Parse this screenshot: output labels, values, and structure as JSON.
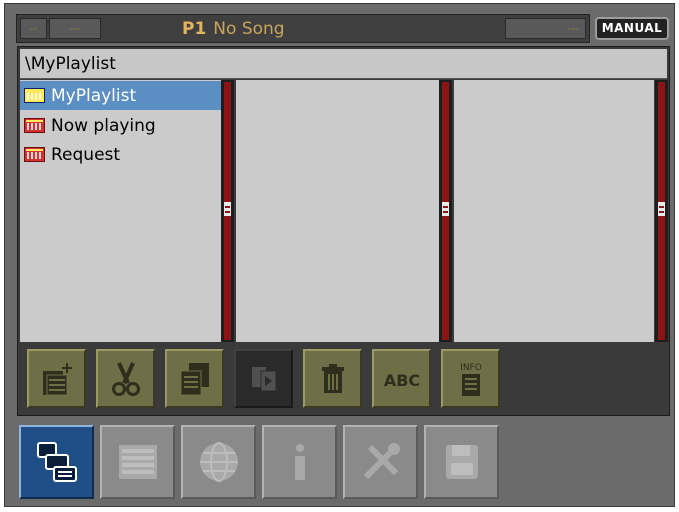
{
  "topbar": {
    "seg_a": "--",
    "seg_b": "---",
    "program": "P1",
    "song": "No Song",
    "seg_c": "---",
    "mode_button": "MANUAL"
  },
  "browser": {
    "path": "\\MyPlaylist",
    "items": [
      {
        "label": "MyPlaylist",
        "icon": "playlist-blue-icon",
        "selected": true
      },
      {
        "label": "Now playing",
        "icon": "playlist-red-icon",
        "selected": false
      },
      {
        "label": "Request",
        "icon": "playlist-red-icon",
        "selected": false
      }
    ]
  },
  "actions": {
    "info_label": "INFO",
    "abc_label": "ABC",
    "buttons": [
      {
        "name": "new-folder-button",
        "icon": "new-folder-icon",
        "enabled": true
      },
      {
        "name": "cut-button",
        "icon": "scissors-icon",
        "enabled": true
      },
      {
        "name": "copy-button",
        "icon": "copy-icon",
        "enabled": true
      },
      {
        "name": "paste-button",
        "icon": "paste-icon",
        "enabled": false
      },
      {
        "name": "delete-button",
        "icon": "trash-icon",
        "enabled": true
      },
      {
        "name": "rename-button",
        "icon": "abc-icon",
        "enabled": true
      },
      {
        "name": "info-button",
        "icon": "info-list-icon",
        "enabled": true
      }
    ]
  },
  "tabs": [
    {
      "name": "tab-browser",
      "icon": "browser-tree-icon",
      "active": true
    },
    {
      "name": "tab-songlist",
      "icon": "song-list-icon",
      "active": false
    },
    {
      "name": "tab-globe",
      "icon": "globe-icon",
      "active": false
    },
    {
      "name": "tab-info",
      "icon": "info-icon",
      "active": false
    },
    {
      "name": "tab-tools",
      "icon": "tools-icon",
      "active": false
    },
    {
      "name": "tab-save",
      "icon": "floppy-disk-icon",
      "active": false
    }
  ],
  "colors": {
    "accent_gold": "#c9a45c",
    "selection_blue": "#5b8fc3",
    "scroll_red": "#8c1414",
    "button_olive": "#6e6e47",
    "active_tab": "#1f4f86"
  }
}
